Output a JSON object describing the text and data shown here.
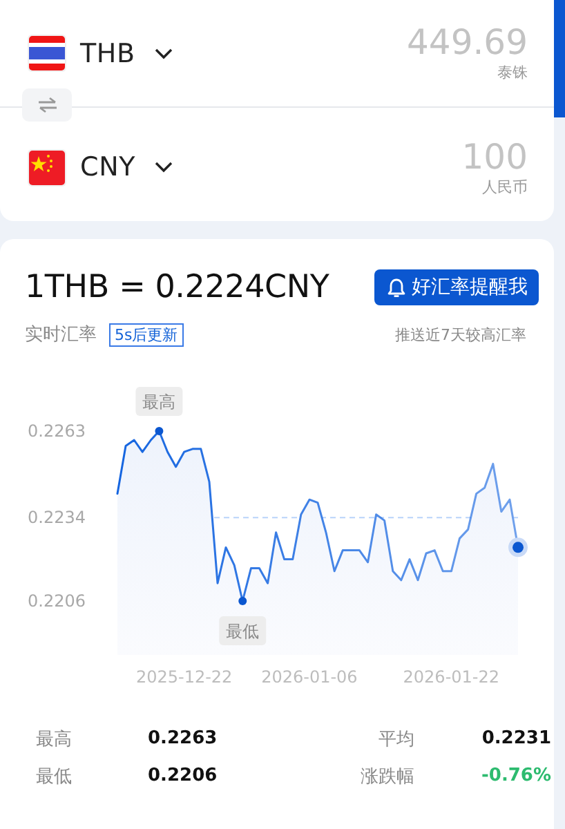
{
  "converter": {
    "rows": [
      {
        "kind": "thailand",
        "code": "THB",
        "amount": "449.69",
        "name": "泰铢"
      },
      {
        "kind": "china",
        "code": "CNY",
        "amount": "100",
        "name": "人民币"
      }
    ]
  },
  "rate": {
    "title": "1THB = 0.2224CNY",
    "alert_button": "好汇率提醒我",
    "label": "实时汇率",
    "update_badge": "5s后更新",
    "alert_note": "推送近7天较高汇率",
    "chart_data": {
      "type": "area",
      "categories": [
        null,
        null,
        null,
        null,
        null,
        null,
        null,
        null,
        "2025-12-22",
        null,
        null,
        null,
        null,
        null,
        null,
        null,
        null,
        null,
        null,
        null,
        null,
        null,
        null,
        "2026-01-06",
        null,
        null,
        null,
        null,
        null,
        null,
        null,
        null,
        null,
        null,
        null,
        null,
        null,
        null,
        null,
        null,
        "2026-01-22",
        null,
        null,
        null,
        null,
        null,
        null,
        null,
        null
      ],
      "series": [
        {
          "color": "#1565e0",
          "values": [
            0.2242,
            0.2258,
            0.226,
            0.2256,
            0.226,
            0.2263,
            0.2256,
            0.2251,
            0.2256,
            0.2257,
            0.2257,
            0.2246,
            0.2212,
            0.2224,
            0.2218,
            0.2206,
            0.2217,
            0.2217,
            0.2212,
            0.2229,
            0.222,
            0.222,
            0.2235,
            0.224,
            0.2239,
            0.2229,
            0.2216,
            0.2223,
            0.2223,
            0.2223,
            0.2219,
            0.2235,
            0.2233,
            0.2216,
            0.2213,
            0.222,
            0.2213,
            0.2222,
            0.2223,
            0.2216,
            0.2216,
            0.2227,
            0.223,
            0.2242,
            0.2244,
            0.2252,
            0.2236,
            0.224,
            0.2224
          ]
        }
      ],
      "ylim": [
        0.2206,
        0.2263
      ],
      "yticks": [
        0.2206,
        0.2234,
        0.2263
      ],
      "annotations": [
        {
          "text": "最高",
          "y": 0.2263
        },
        {
          "text": "最低",
          "y": 0.2206
        }
      ]
    },
    "stats": [
      {
        "label": "最高",
        "value": "0.2263",
        "kind": "plain"
      },
      {
        "label": "平均",
        "value": "0.2231",
        "kind": "plain"
      },
      {
        "label": "最低",
        "value": "0.2206",
        "kind": "plain"
      },
      {
        "label": "涨跌幅",
        "value": "-0.76%",
        "kind": "change"
      }
    ]
  }
}
